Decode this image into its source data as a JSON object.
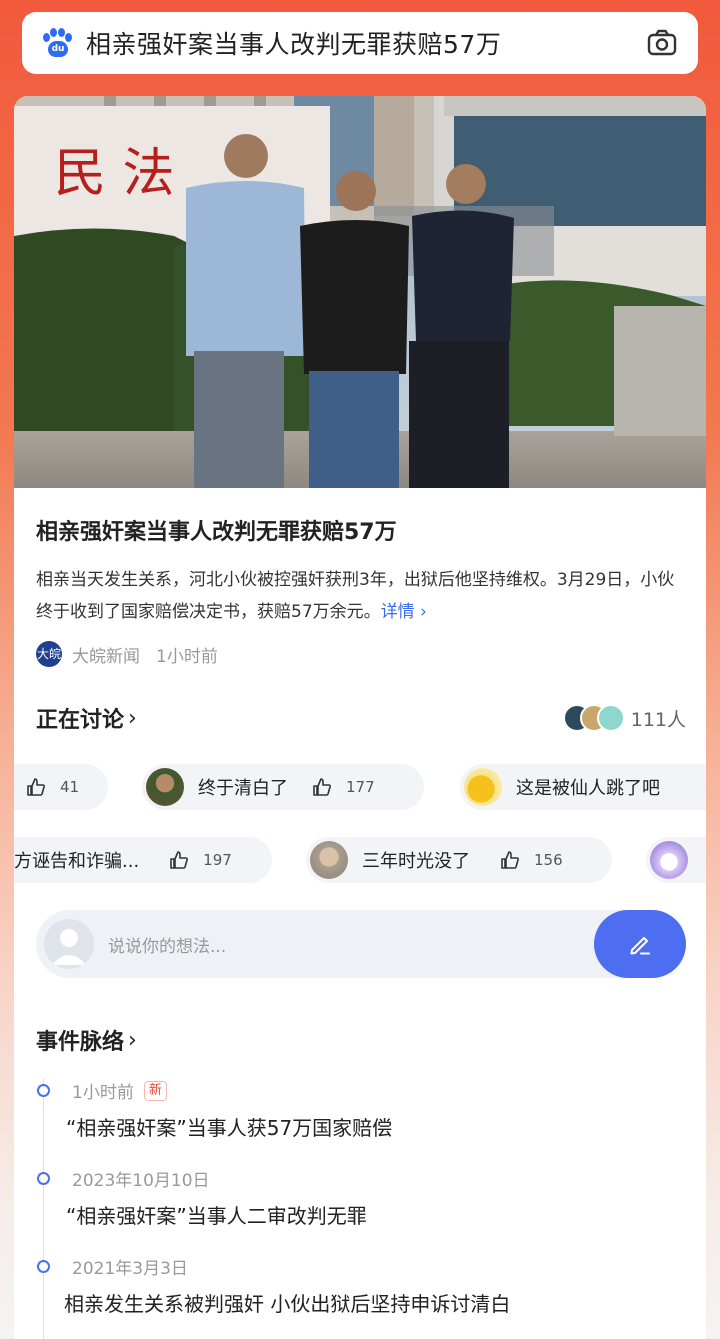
{
  "search": {
    "query": "相亲强奸案当事人改判无罪获赔57万"
  },
  "article": {
    "title": "相亲强奸案当事人改判无罪获赔57万",
    "summary": "相亲当天发生关系，河北小伙被控强奸获刑3年，出狱后他坚持维权。3月29日，小伙终于收到了国家赔偿决定书，获赔57万余元。",
    "more_label": "详情 ›",
    "source_logo_text": "大皖",
    "source_name": "大皖新闻",
    "time": "1小时前",
    "photo_sign_text": "民 法"
  },
  "discussion": {
    "heading": "正在讨论",
    "chevron": "›",
    "participants": "111人",
    "row1": [
      {
        "text": "",
        "likes": "41"
      },
      {
        "text": "终于清白了",
        "likes": "177"
      },
      {
        "text": "这是被仙人跳了吧",
        "likes": ""
      }
    ],
    "row2": [
      {
        "text": "方诬告和诈骗...",
        "likes": "197"
      },
      {
        "text": "三年时光没了",
        "likes": "156"
      }
    ]
  },
  "comment": {
    "placeholder": "说说你的想法..."
  },
  "timeline": {
    "heading": "事件脉络",
    "chevron": "›",
    "items": [
      {
        "date": "1小时前",
        "badge": "新",
        "text": "“相亲强奸案”当事人获57万国家赔偿"
      },
      {
        "date": "2023年10月10日",
        "badge": "",
        "text": "“相亲强奸案”当事人二审改判无罪"
      },
      {
        "date": "2021年3月3日",
        "badge": "",
        "text": "相亲发生关系被判强奸 小伙出狱后坚持申诉讨清白"
      }
    ]
  },
  "colors": {
    "accent": "#4e6ef2",
    "brand_red": "#f15a3c",
    "link": "#3a6ee8"
  }
}
